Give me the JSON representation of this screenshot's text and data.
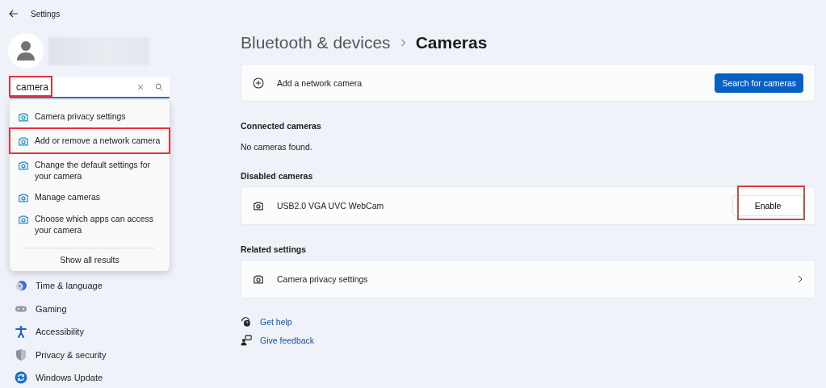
{
  "window": {
    "title": "Settings"
  },
  "search": {
    "value": "camera",
    "highlighted": true
  },
  "search_results": [
    {
      "label": "Camera privacy settings",
      "highlighted": false
    },
    {
      "label": "Add or remove a network camera",
      "highlighted": true
    },
    {
      "label": "Change the default settings for your camera",
      "highlighted": false
    },
    {
      "label": "Manage cameras",
      "highlighted": false
    },
    {
      "label": "Choose which apps can access your camera",
      "highlighted": false
    }
  ],
  "show_all": "Show all results",
  "sidebar": {
    "items": [
      {
        "label": "Time & language",
        "kind": "time"
      },
      {
        "label": "Gaming",
        "kind": "gaming"
      },
      {
        "label": "Accessibility",
        "kind": "accessibility"
      },
      {
        "label": "Privacy & security",
        "kind": "privacy"
      },
      {
        "label": "Windows Update",
        "kind": "update"
      }
    ]
  },
  "breadcrumb": {
    "parent": "Bluetooth & devices",
    "current": "Cameras"
  },
  "add_camera": {
    "label": "Add a network camera",
    "button": "Search for cameras"
  },
  "sections": [
    {
      "title": "Connected cameras",
      "empty_text": "No cameras found."
    },
    {
      "title": "Disabled cameras",
      "rows": [
        {
          "label": "USB2.0 VGA UVC WebCam",
          "button": "Enable",
          "highlighted": true
        }
      ]
    },
    {
      "title": "Related settings",
      "rows": [
        {
          "label": "Camera privacy settings",
          "chevron": true
        }
      ]
    }
  ],
  "help_links": [
    {
      "label": "Get help",
      "kind": "help"
    },
    {
      "label": "Give feedback",
      "kind": "feedback"
    }
  ]
}
